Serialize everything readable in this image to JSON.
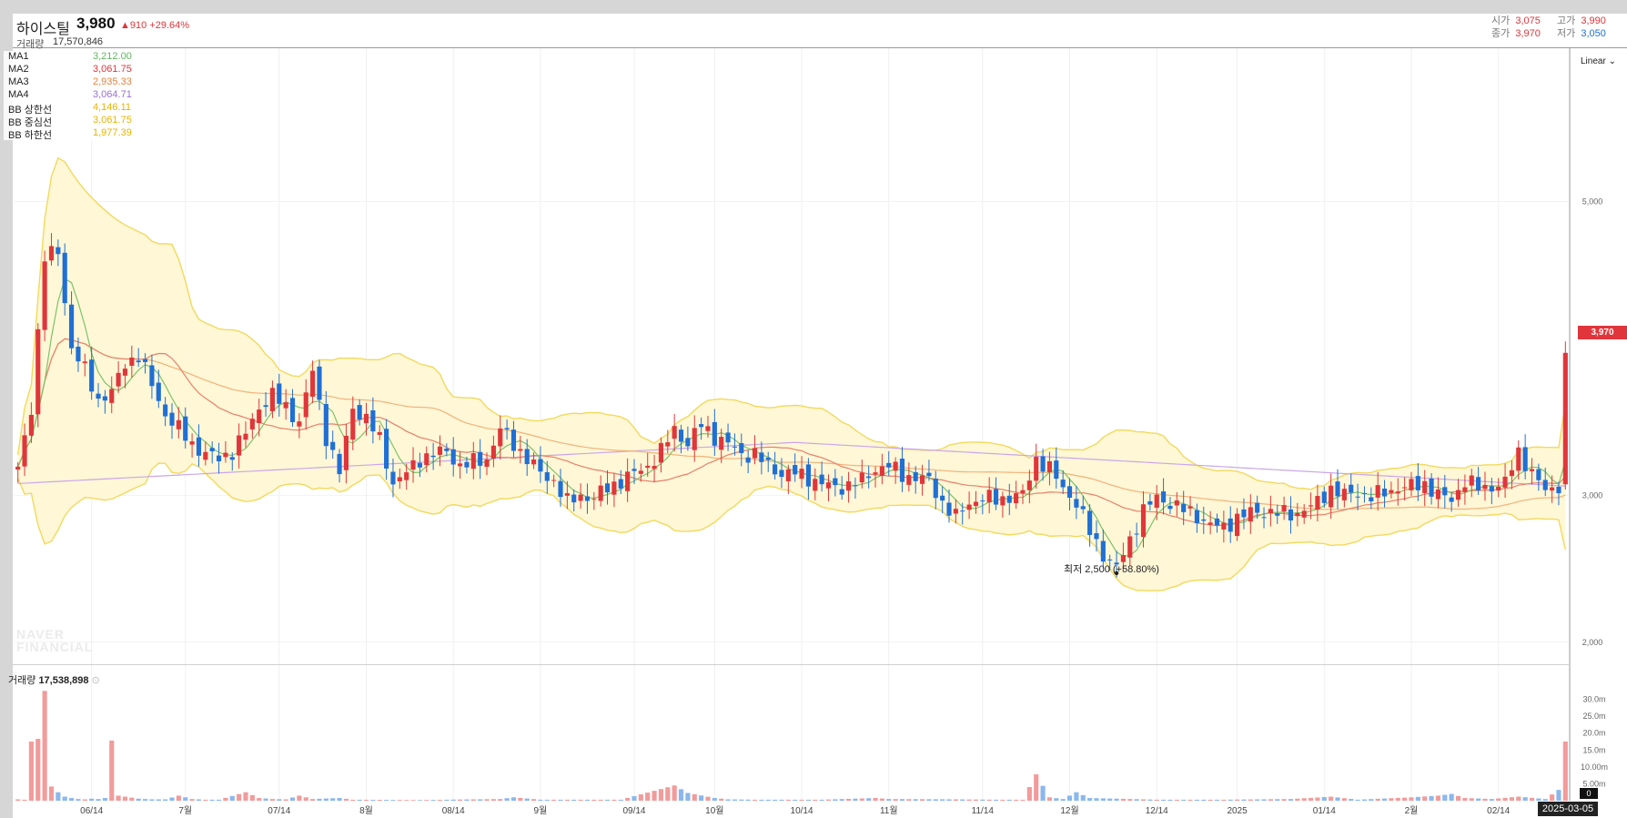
{
  "header": {
    "stock_name": "하이스틸",
    "price": "3,980",
    "change": "▲910 +29.64%",
    "volume_label": "거래량",
    "volume_value": "17,570,846",
    "open_label": "시가",
    "open_value": "3,075",
    "high_label": "고가",
    "high_value": "3,990",
    "close_label": "종가",
    "close_value": "3,970",
    "low_label": "저가",
    "low_value": "3,050"
  },
  "legend": {
    "items": [
      {
        "name": "MA1",
        "value": "3,212.00",
        "color": "#5cb85c"
      },
      {
        "name": "MA2",
        "value": "3,061.75",
        "color": "#e0363b"
      },
      {
        "name": "MA3",
        "value": "2,935.33",
        "color": "#e8823c"
      },
      {
        "name": "MA4",
        "value": "3,064.71",
        "color": "#9b6fd6"
      },
      {
        "name": "BB 상한선",
        "value": "4,146.11",
        "color": "#e8b400"
      },
      {
        "name": "BB 중심선",
        "value": "3,061.75",
        "color": "#e8b400"
      },
      {
        "name": "BB 하한선",
        "value": "1,977.39",
        "color": "#e8b400"
      }
    ]
  },
  "scale_mode": "Linear",
  "price_tag": "3,970",
  "low_annotation": "최저 2,500 (+58.80%)",
  "watermark_lines": [
    "NAVER",
    "FINANCIAL"
  ],
  "volume_panel": {
    "label": "거래량",
    "value": "17,538,898"
  },
  "current_date": "2025-03-05",
  "colors": {
    "up": "#e0363b",
    "down": "#1f6fd6",
    "band_fill": "#fff7d6",
    "band_line": "#f2d95c"
  },
  "chart_data": {
    "type": "candlestick",
    "price_axis": {
      "min": 1850,
      "max": 6050,
      "ticks": [
        2000,
        3000,
        5000
      ],
      "tick_labels": [
        "2,000",
        "3,000",
        "5,000"
      ]
    },
    "volume_axis": {
      "min": 0,
      "max": 35,
      "unit": "m",
      "ticks": [
        "5.00m",
        "10.00m",
        "15.0m",
        "20.0m",
        "25.0m",
        "30.0m"
      ],
      "tick_values": [
        5,
        10,
        15,
        20,
        25,
        30
      ],
      "zero_label": "0"
    },
    "x_axis_labels": [
      "06/14",
      "7월",
      "07/14",
      "8월",
      "08/14",
      "9월",
      "09/14",
      "10월",
      "10/14",
      "11월",
      "11/14",
      "12월",
      "12/14",
      "2025",
      "01/14",
      "2월",
      "02/14"
    ],
    "x_axis_label_positions": [
      11,
      25,
      39,
      52,
      65,
      78,
      92,
      104,
      117,
      130,
      144,
      157,
      170,
      182,
      195,
      208,
      221
    ],
    "bar_count": 232,
    "anchors": {
      "close": [
        [
          0,
          3170
        ],
        [
          2,
          3600
        ],
        [
          4,
          4620
        ],
        [
          6,
          4660
        ],
        [
          8,
          4000
        ],
        [
          10,
          3850
        ],
        [
          12,
          3650
        ],
        [
          14,
          3700
        ],
        [
          16,
          3900
        ],
        [
          18,
          3950
        ],
        [
          20,
          3750
        ],
        [
          22,
          3550
        ],
        [
          24,
          3450
        ],
        [
          26,
          3350
        ],
        [
          28,
          3280
        ],
        [
          30,
          3250
        ],
        [
          32,
          3300
        ],
        [
          34,
          3420
        ],
        [
          36,
          3600
        ],
        [
          38,
          3680
        ],
        [
          40,
          3600
        ],
        [
          42,
          3500
        ],
        [
          44,
          3850
        ],
        [
          46,
          3400
        ],
        [
          48,
          3150
        ],
        [
          50,
          3600
        ],
        [
          52,
          3520
        ],
        [
          54,
          3380
        ],
        [
          56,
          3080
        ],
        [
          58,
          3150
        ],
        [
          60,
          3250
        ],
        [
          62,
          3280
        ],
        [
          64,
          3300
        ],
        [
          66,
          3200
        ],
        [
          70,
          3250
        ],
        [
          72,
          3450
        ],
        [
          74,
          3350
        ],
        [
          76,
          3250
        ],
        [
          78,
          3150
        ],
        [
          80,
          3100
        ],
        [
          82,
          2950
        ],
        [
          84,
          3000
        ],
        [
          86,
          2980
        ],
        [
          88,
          3050
        ],
        [
          90,
          3100
        ],
        [
          92,
          3150
        ],
        [
          94,
          3200
        ],
        [
          96,
          3300
        ],
        [
          98,
          3450
        ],
        [
          100,
          3350
        ],
        [
          102,
          3480
        ],
        [
          104,
          3400
        ],
        [
          106,
          3350
        ],
        [
          108,
          3280
        ],
        [
          110,
          3280
        ],
        [
          112,
          3200
        ],
        [
          114,
          3150
        ],
        [
          116,
          3150
        ],
        [
          118,
          3120
        ],
        [
          120,
          3080
        ],
        [
          122,
          3050
        ],
        [
          124,
          3070
        ],
        [
          126,
          3100
        ],
        [
          128,
          3180
        ],
        [
          130,
          3200
        ],
        [
          132,
          3140
        ],
        [
          134,
          3120
        ],
        [
          136,
          3100
        ],
        [
          138,
          2950
        ],
        [
          140,
          2850
        ],
        [
          142,
          2950
        ],
        [
          144,
          2980
        ],
        [
          146,
          2970
        ],
        [
          148,
          2990
        ],
        [
          150,
          3000
        ],
        [
          152,
          3250
        ],
        [
          154,
          3180
        ],
        [
          156,
          3050
        ],
        [
          158,
          2950
        ],
        [
          160,
          2750
        ],
        [
          162,
          2600
        ],
        [
          164,
          2500
        ],
        [
          166,
          2700
        ],
        [
          168,
          2900
        ],
        [
          170,
          2980
        ],
        [
          172,
          2950
        ],
        [
          174,
          2900
        ],
        [
          176,
          2860
        ],
        [
          178,
          2800
        ],
        [
          180,
          2780
        ],
        [
          182,
          2850
        ],
        [
          184,
          2880
        ],
        [
          186,
          2890
        ],
        [
          188,
          2880
        ],
        [
          190,
          2870
        ],
        [
          192,
          2900
        ],
        [
          194,
          2950
        ],
        [
          196,
          3050
        ],
        [
          198,
          3000
        ],
        [
          200,
          3020
        ],
        [
          202,
          2990
        ],
        [
          204,
          3020
        ],
        [
          206,
          3050
        ],
        [
          208,
          3060
        ],
        [
          210,
          3080
        ],
        [
          212,
          3000
        ],
        [
          214,
          2970
        ],
        [
          216,
          3100
        ],
        [
          218,
          3050
        ],
        [
          220,
          3060
        ],
        [
          222,
          3080
        ],
        [
          224,
          3300
        ],
        [
          226,
          3150
        ],
        [
          228,
          3030
        ],
        [
          230,
          3070
        ],
        [
          231,
          3970
        ]
      ],
      "volume": [
        [
          0,
          0.4
        ],
        [
          1,
          0.3
        ],
        [
          2,
          17.5
        ],
        [
          3,
          18.3
        ],
        [
          4,
          32.5
        ],
        [
          5,
          4.2
        ],
        [
          6,
          2.5
        ],
        [
          7,
          1.2
        ],
        [
          8,
          0.8
        ],
        [
          9,
          0.5
        ],
        [
          10,
          0.4
        ],
        [
          11,
          0.6
        ],
        [
          12,
          0.5
        ],
        [
          13,
          0.8
        ],
        [
          14,
          17.8
        ],
        [
          15,
          1.5
        ],
        [
          16,
          1.2
        ],
        [
          17,
          0.9
        ],
        [
          18,
          0.6
        ],
        [
          19,
          0.5
        ],
        [
          20,
          0.4
        ],
        [
          22,
          0.4
        ],
        [
          24,
          1.5
        ],
        [
          26,
          0.5
        ],
        [
          28,
          0.3
        ],
        [
          30,
          0.3
        ],
        [
          34,
          2.5
        ],
        [
          36,
          0.8
        ],
        [
          38,
          0.5
        ],
        [
          40,
          0.4
        ],
        [
          42,
          1.5
        ],
        [
          44,
          0.5
        ],
        [
          48,
          0.8
        ],
        [
          50,
          0.3
        ],
        [
          60,
          0.2
        ],
        [
          72,
          0.5
        ],
        [
          74,
          1.0
        ],
        [
          78,
          0.3
        ],
        [
          90,
          0.3
        ],
        [
          98,
          4.5
        ],
        [
          100,
          2.3
        ],
        [
          104,
          0.8
        ],
        [
          106,
          0.4
        ],
        [
          110,
          0.3
        ],
        [
          120,
          0.3
        ],
        [
          128,
          0.8
        ],
        [
          130,
          0.5
        ],
        [
          140,
          0.4
        ],
        [
          146,
          0.3
        ],
        [
          150,
          0.3
        ],
        [
          152,
          7.8
        ],
        [
          154,
          1.0
        ],
        [
          156,
          0.5
        ],
        [
          158,
          2.5
        ],
        [
          160,
          0.8
        ],
        [
          166,
          0.5
        ],
        [
          170,
          0.3
        ],
        [
          180,
          0.3
        ],
        [
          190,
          0.5
        ],
        [
          196,
          1.2
        ],
        [
          200,
          0.3
        ],
        [
          208,
          1.0
        ],
        [
          212,
          1.5
        ],
        [
          214,
          2.0
        ],
        [
          216,
          0.8
        ],
        [
          220,
          0.5
        ],
        [
          224,
          1.2
        ],
        [
          228,
          0.5
        ],
        [
          230,
          3.2
        ],
        [
          231,
          17.5
        ]
      ],
      "ma_long_start": 3080,
      "ma_long_end": 3060
    }
  }
}
